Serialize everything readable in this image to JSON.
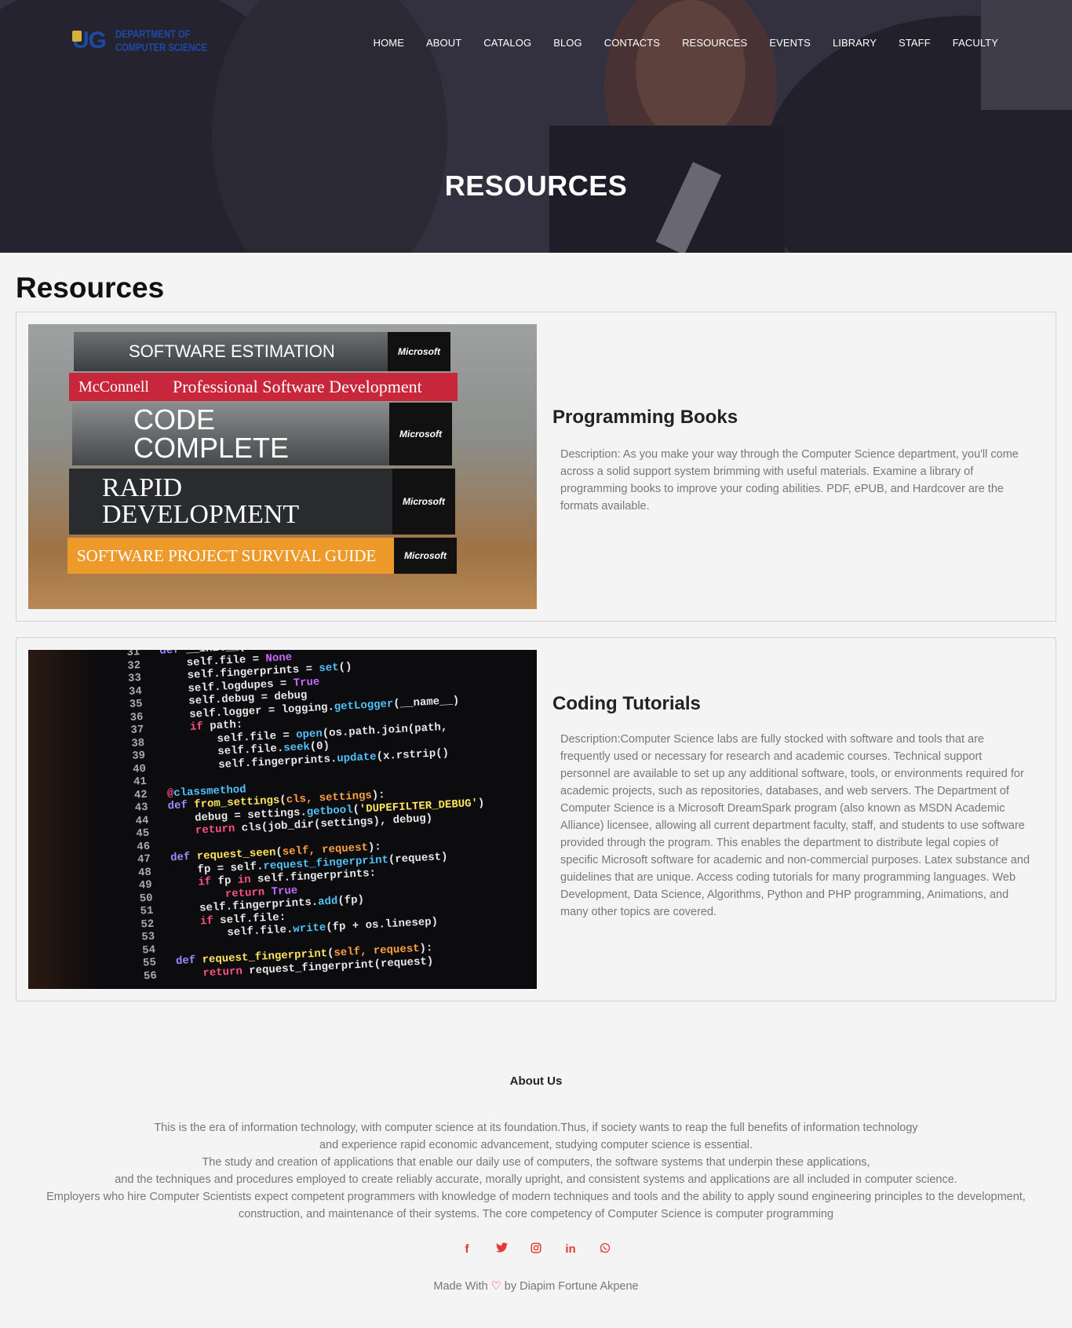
{
  "logo": {
    "short": "UG",
    "line1": "DEPARTMENT OF",
    "line2": "COMPUTER SCIENCE"
  },
  "nav": [
    "HOME",
    "ABOUT",
    "CATALOG",
    "BLOG",
    "CONTACTS",
    "RESOURCES",
    "EVENTS",
    "LIBRARY",
    "STAFF",
    "FACULTY"
  ],
  "hero": {
    "title": "RESOURCES"
  },
  "page": {
    "heading": "Resources"
  },
  "cards": [
    {
      "title": "Programming Books",
      "description": "Description: As you make your way through the Computer Science department, you'll come across a solid support system brimming with useful materials. Examine a library of programming books to improve your coding abilities. PDF, ePUB, and Hardcover are the formats available.",
      "books": [
        "SOFTWARE ESTIMATION",
        "Professional Software Development",
        "CODE COMPLETE",
        "RAPID DEVELOPMENT",
        "SOFTWARE PROJECT SURVIVAL GUIDE"
      ]
    },
    {
      "title": "Coding Tutorials",
      "description": "Description:Computer Science labs are fully stocked with software and tools that are frequently used or necessary for research and academic courses. Technical support personnel are available to set up any additional software, tools, or environments required for academic projects, such as repositories, databases, and web servers. The Department of Computer Science is a Microsoft DreamSpark program (also known as MSDN Academic Alliance) licensee, allowing all current department faculty, staff, and students to use software provided through the program. This enables the department to distribute legal copies of specific Microsoft software for academic and non-commercial purposes. Latex substance and guidelines that are unique. Access coding tutorials for many programming languages. Web Development, Data Science, Algorithms, Python and PHP programming, Animations, and many other topics are covered."
    }
  ],
  "footer": {
    "heading": "About Us",
    "lines": [
      "This is the era of information technology, with computer science at its foundation.Thus, if society wants to reap the full benefits of information technology",
      "and experience rapid economic advancement, studying computer science is essential.",
      "The study and creation of applications that enable our daily use of computers, the software systems that underpin these applications,",
      "and the techniques and procedures employed to create reliably accurate, morally upright, and consistent systems and applications are all included in computer science.",
      "Employers who hire Computer Scientists expect competent programmers with knowledge of modern techniques and tools and the ability to apply sound engineering principles to the development, construction, and maintenance of their systems. The core competency of Computer Science is computer programming"
    ],
    "social": [
      "facebook-icon",
      "twitter-icon",
      "instagram-icon",
      "linkedin-icon",
      "whatsapp-icon"
    ],
    "made_prefix": "Made With",
    "made_suffix": "by Diapim Fortune Akpene"
  },
  "colors": {
    "accent": "#e53935",
    "logo_blue": "#1e4aa3"
  }
}
